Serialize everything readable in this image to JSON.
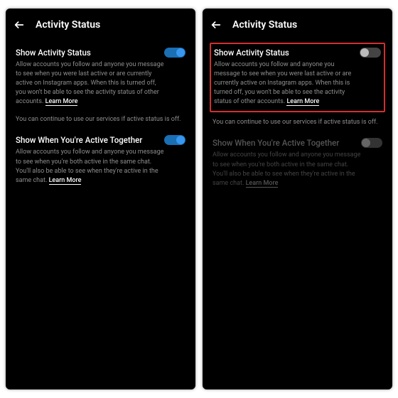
{
  "left": {
    "header": "Activity Status",
    "setting1": {
      "title": "Show Activity Status",
      "desc_prefix": "Allow accounts you follow and anyone you message to see when you were last active or are currently active on Instagram apps. When this is turned off, you won't be able to see the activity status of other accounts. ",
      "learn": "Learn More",
      "on": true
    },
    "note": "You can continue to use our services if active status is off.",
    "setting2": {
      "title": "Show When You're Active Together",
      "desc_prefix": "Allow accounts you follow and anyone you message to see when you're both active in the same chat. You'll also be able to see when they're active in the same chat. ",
      "learn": "Learn More",
      "on": true
    }
  },
  "right": {
    "header": "Activity Status",
    "setting1": {
      "title": "Show Activity Status",
      "desc_prefix": "Allow accounts you follow and anyone you message to see when you were last active or are currently active on Instagram apps. When this is turned off, you won't be able to see the activity status of other accounts. ",
      "learn": "Learn More",
      "on": false
    },
    "note": "You can continue to use our services if active status is off.",
    "setting2": {
      "title": "Show When You're Active Together",
      "desc_prefix": "Allow accounts you follow and anyone you message to see when you're both active in the same chat. You'll also be able to see when they're active in the same chat. ",
      "learn": "Learn More",
      "on": false,
      "dimmed": true
    }
  }
}
